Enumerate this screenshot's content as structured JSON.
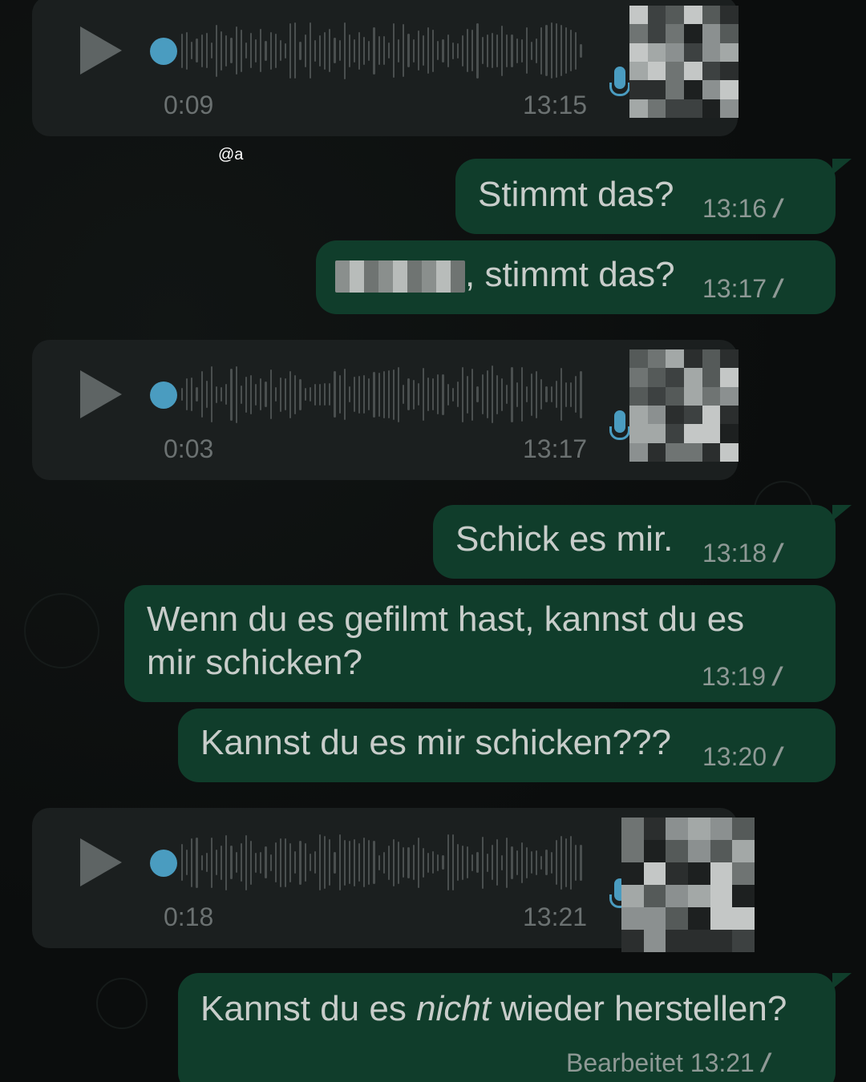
{
  "watermark": "@a",
  "messages": [
    {
      "type": "voice",
      "duration": "0:09",
      "time": "13:15"
    },
    {
      "type": "text",
      "text": "Stimmt das?",
      "time": "13:16",
      "ticks": "//"
    },
    {
      "type": "text",
      "text": ", stimmt das?",
      "time": "13:17",
      "ticks": "//"
    },
    {
      "type": "voice",
      "duration": "0:03",
      "time": "13:17"
    },
    {
      "type": "text",
      "text": "Schick es mir.",
      "time": "13:18",
      "ticks": "//"
    },
    {
      "type": "text",
      "text_line1": "Wenn du es gefilmt hast, kannst du es",
      "text_line2": "mir schicken?",
      "time": "13:19",
      "ticks": "//"
    },
    {
      "type": "text",
      "text": "Kannst du es mir schicken???",
      "time": "13:20",
      "ticks": "//"
    },
    {
      "type": "voice",
      "duration": "0:18",
      "time": "13:21"
    },
    {
      "type": "text",
      "text_before": "Kannst du es ",
      "text_italic": "nicht",
      "text_after": " wieder herstellen?",
      "edited_label": "Bearbeitet",
      "time": "13:21",
      "ticks": "//"
    }
  ],
  "icons": {
    "play": "play-icon",
    "mic": "microphone-icon",
    "read": "double-check-icon"
  },
  "colors": {
    "background": "#0b0d0d",
    "incoming_bubble": "#1b1f1f",
    "outgoing_bubble": "#103d2b",
    "progress_dot": "#4a9cc0"
  }
}
